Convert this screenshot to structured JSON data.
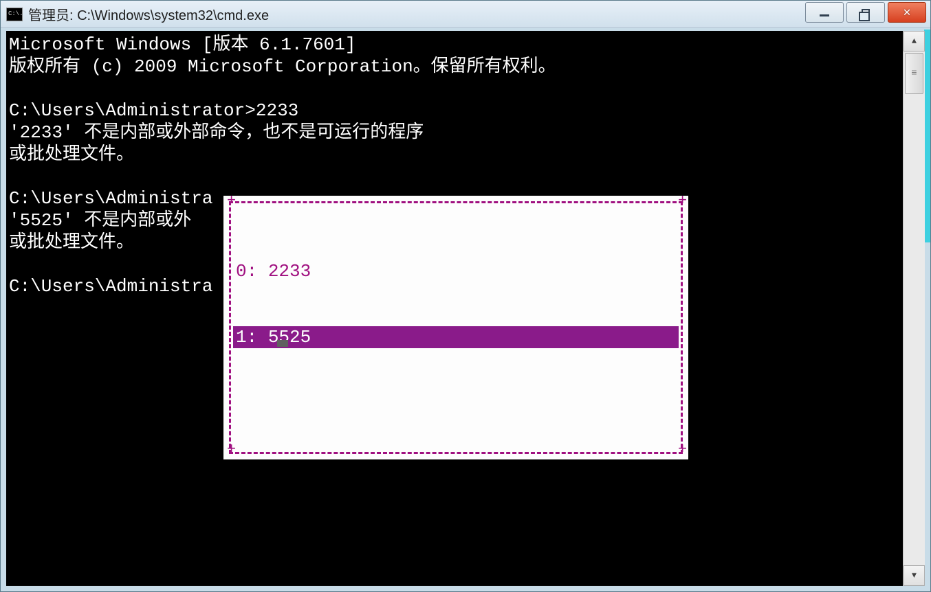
{
  "titlebar": {
    "icon_text": "C:\\.",
    "title": "管理员: C:\\Windows\\system32\\cmd.exe"
  },
  "terminal": {
    "line1": "Microsoft Windows [版本 6.1.7601]",
    "line2": "版权所有 (c) 2009 Microsoft Corporation。保留所有权利。",
    "line3": "",
    "line4": "C:\\Users\\Administrator>2233",
    "line5": "'2233' 不是内部或外部命令，也不是可运行的程序",
    "line6": "或批处理文件。",
    "line7": "",
    "line8": "C:\\Users\\Administra",
    "line9": "'5525' 不是内部或外",
    "line10": "或批处理文件。",
    "line11": "",
    "line12": "C:\\Users\\Administra"
  },
  "history": {
    "items": [
      {
        "idx": "0:",
        "cmd": "2233",
        "selected": false
      },
      {
        "idx": "1:",
        "cmd": "5525",
        "selected": true
      }
    ]
  },
  "colors": {
    "terminal_bg": "#000000",
    "terminal_fg": "#ffffff",
    "popup_border": "#a01080",
    "popup_selected_bg": "#8a1b8a",
    "close_btn": "#d64020"
  }
}
